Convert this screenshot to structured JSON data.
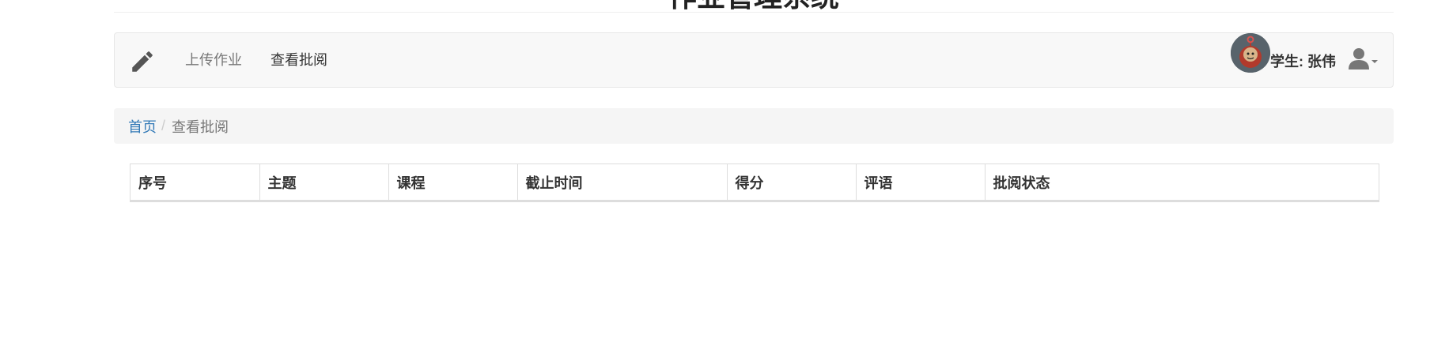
{
  "header": {
    "title": "作业管理系统"
  },
  "navbar": {
    "brand_icon": "pencil-icon",
    "links": [
      {
        "label": "上传作业"
      },
      {
        "label": "查看批阅"
      }
    ],
    "user": {
      "avatar": "avatar",
      "label": "学生: 张伟",
      "menu_icon": "user-icon"
    }
  },
  "breadcrumb": {
    "home": "首页",
    "separator": "/",
    "current": "查看批阅"
  },
  "table": {
    "columns": [
      "序号",
      "主题",
      "课程",
      "截止时间",
      "得分",
      "评语",
      "批阅状态"
    ],
    "rows": []
  },
  "colors": {
    "link": "#337ab7",
    "navbar_bg": "#f8f8f8",
    "breadcrumb_bg": "#f5f5f5"
  }
}
